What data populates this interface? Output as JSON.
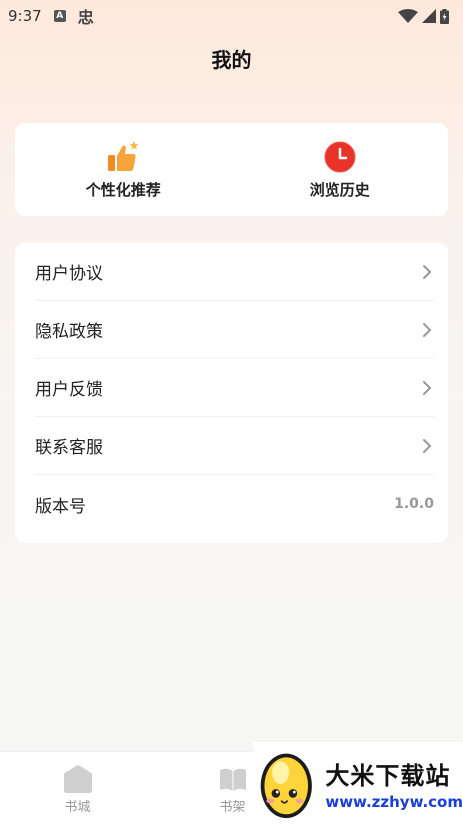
{
  "status": {
    "time": "9:37",
    "notif_a": "A",
    "notif_glyph": "忠"
  },
  "header": {
    "title": "我的"
  },
  "quick_actions": [
    {
      "label": "个性化推荐",
      "icon": "thumbs-up-icon"
    },
    {
      "label": "浏览历史",
      "icon": "clock-icon"
    }
  ],
  "menu": {
    "items": [
      {
        "label": "用户协议"
      },
      {
        "label": "隐私政策"
      },
      {
        "label": "用户反馈"
      },
      {
        "label": "联系客服"
      }
    ],
    "version_label": "版本号",
    "version_value": "1.0.0"
  },
  "tabbar": {
    "tabs": [
      {
        "label": "书城",
        "icon": "book-city-icon"
      },
      {
        "label": "书架",
        "icon": "bookshelf-icon"
      }
    ]
  },
  "watermark": {
    "name": "大米下载站",
    "url": "www.zzhyw.com"
  },
  "colors": {
    "accent_orange": "#f5a33b",
    "clock_red": "#e8322a",
    "watermark_blue": "#1a3fd6"
  }
}
